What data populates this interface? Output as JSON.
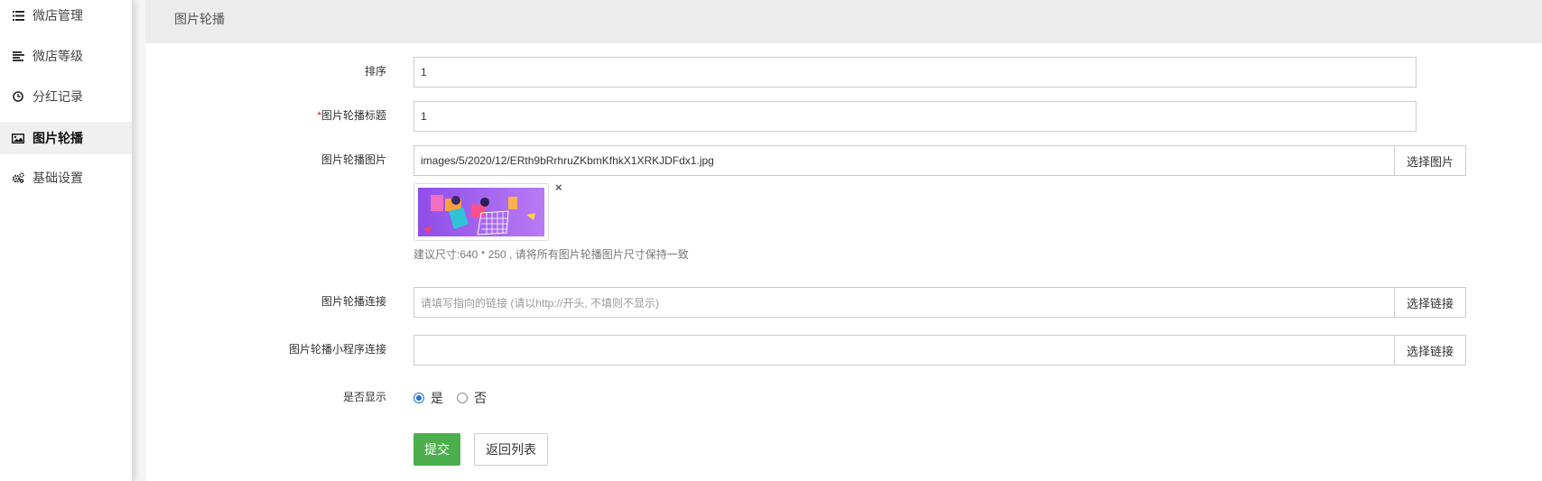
{
  "sidebar": {
    "items": [
      {
        "label": "微店管理",
        "icon": "list-icon"
      },
      {
        "label": "微店等级",
        "icon": "align-left-icon"
      },
      {
        "label": "分红记录",
        "icon": "clock-icon"
      },
      {
        "label": "图片轮播",
        "icon": "image-icon",
        "active": true
      },
      {
        "label": "基础设置",
        "icon": "gears-icon"
      }
    ]
  },
  "header": {
    "title": "图片轮播"
  },
  "form": {
    "sort": {
      "label": "排序",
      "value": "1"
    },
    "title": {
      "required_mark": "*",
      "label": "图片轮播标题",
      "value": "1"
    },
    "image": {
      "label": "图片轮播图片",
      "value": "images/5/2020/12/ERth9bRrhruZKbmKfhkX1XRKJDFdx1.jpg",
      "button": "选择图片",
      "remove": "×",
      "help": "建议尺寸:640 * 250 , 请将所有图片轮播图片尺寸保持一致"
    },
    "link": {
      "label": "图片轮播连接",
      "placeholder": "请填写指向的链接 (请以http://开头, 不填则不显示)",
      "button": "选择链接"
    },
    "mini_link": {
      "label": "图片轮播小程序连接",
      "value": "",
      "button": "选择链接"
    },
    "display": {
      "label": "是否显示",
      "yes": "是",
      "no": "否",
      "selected": "是"
    },
    "submit": "提交",
    "back": "返回列表"
  },
  "colors": {
    "primary": "#4cae4c",
    "radio": "#1e6fd9",
    "header_bg": "#ececec"
  }
}
